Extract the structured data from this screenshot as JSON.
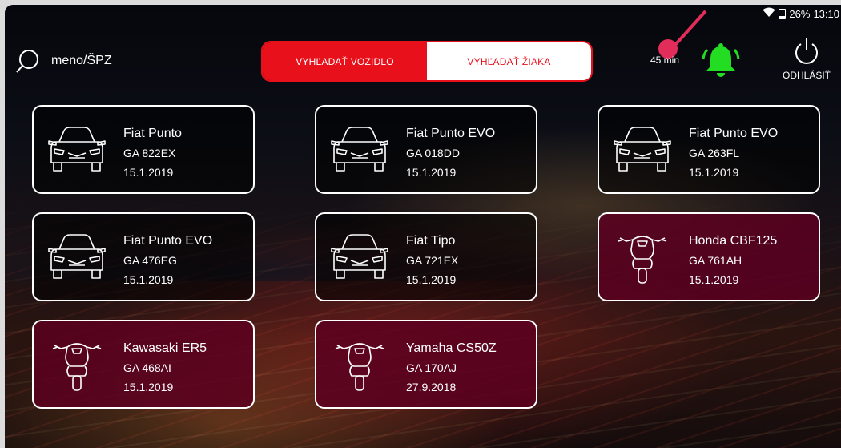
{
  "status_bar": {
    "battery": "26%",
    "time": "13:10"
  },
  "search": {
    "placeholder": "meno/ŠPZ"
  },
  "mode_toggle": {
    "vehicle_label": "VYHĽADAŤ VOZIDLO",
    "student_label": "VYHĽADAŤ ŽIAKA",
    "active": "vehicle"
  },
  "timer": "45 min",
  "logout_label": "ODHLÁSIŤ",
  "colors": {
    "accent_red": "#e8101a",
    "bell_green": "#22dd22",
    "moto_bg": "#5c0020",
    "pointer_pink": "#e22d5a"
  },
  "vehicles": [
    {
      "type": "car",
      "icon": "car-icon",
      "name": "Fiat Punto",
      "plate": "GA 822EX",
      "date": "15.1.2019"
    },
    {
      "type": "car",
      "icon": "car-icon",
      "name": "Fiat Punto EVO",
      "plate": "GA 018DD",
      "date": "15.1.2019"
    },
    {
      "type": "car",
      "icon": "car-icon",
      "name": "Fiat Punto EVO",
      "plate": "GA 263FL",
      "date": "15.1.2019"
    },
    {
      "type": "car",
      "icon": "car-icon",
      "name": "Fiat Punto EVO",
      "plate": "GA 476EG",
      "date": "15.1.2019"
    },
    {
      "type": "car",
      "icon": "car-icon",
      "name": "Fiat Tipo",
      "plate": "GA 721EX",
      "date": "15.1.2019"
    },
    {
      "type": "moto",
      "icon": "motorcycle-icon",
      "name": "Honda CBF125",
      "plate": "GA 761AH",
      "date": "15.1.2019"
    },
    {
      "type": "moto",
      "icon": "motorcycle-icon",
      "name": "Kawasaki ER5",
      "plate": "GA 468AI",
      "date": "15.1.2019"
    },
    {
      "type": "moto",
      "icon": "motorcycle-icon",
      "name": "Yamaha CS50Z",
      "plate": "GA 170AJ",
      "date": "27.9.2018"
    }
  ]
}
